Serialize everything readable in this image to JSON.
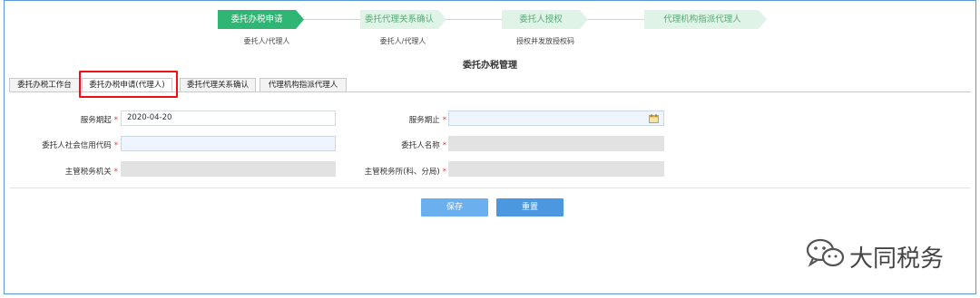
{
  "steps": [
    {
      "label": "委托办税申请",
      "sub": "委托人/代理人",
      "active": true
    },
    {
      "label": "委托代理关系确认",
      "sub": "委托人/代理人",
      "active": false
    },
    {
      "label": "委托人授权",
      "sub": "授权并发放授权码",
      "active": false
    },
    {
      "label": "代理机构指派代理人",
      "sub": "",
      "active": false
    }
  ],
  "page_title": "委托办税管理",
  "tabs": [
    {
      "label": "委托办税工作台"
    },
    {
      "label": "委托办税申请(代理人)"
    },
    {
      "label": "委托代理关系确认"
    },
    {
      "label": "代理机构指派代理人"
    }
  ],
  "form": {
    "service_start_label": "服务期起",
    "service_start_value": "2020-04-20",
    "service_end_label": "服务期止",
    "service_end_value": "",
    "credit_code_label": "委托人社会信用代码",
    "credit_code_value": "",
    "client_name_label": "委托人名称",
    "client_name_value": "",
    "tax_authority_label": "主管税务机关",
    "tax_authority_value": "",
    "tax_office_label": "主管税务所(科、分局)",
    "tax_office_value": "",
    "required_mark": "*"
  },
  "buttons": {
    "save": "保存",
    "reset": "重置"
  },
  "watermark": {
    "text": "大同税务"
  },
  "colors": {
    "step_active": "#2fb574",
    "step_inactive": "#dff3e6",
    "accent_blue": "#4b97e0",
    "highlight": "#e11111"
  }
}
